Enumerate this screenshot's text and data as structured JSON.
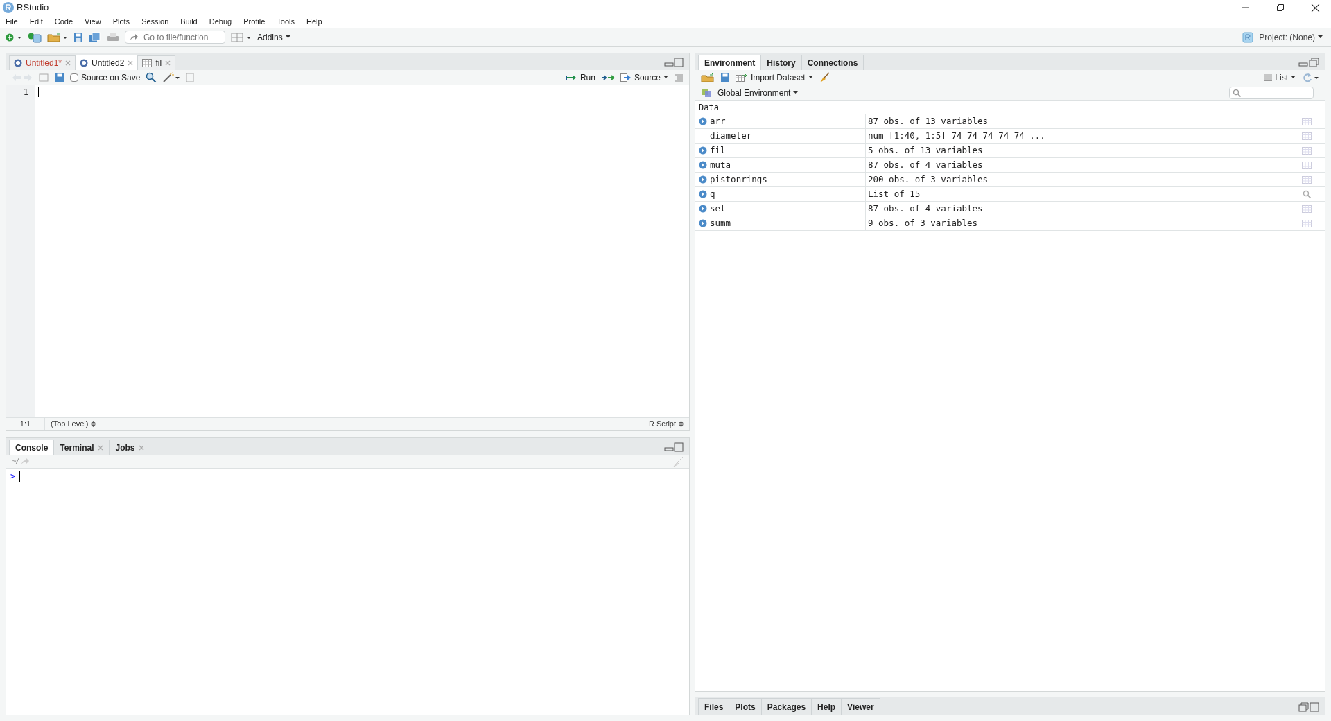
{
  "window": {
    "title": "RStudio"
  },
  "menu": [
    "File",
    "Edit",
    "Code",
    "View",
    "Plots",
    "Session",
    "Build",
    "Debug",
    "Profile",
    "Tools",
    "Help"
  ],
  "toolbar": {
    "goto_placeholder": "Go to file/function",
    "addins": "Addins",
    "project": "Project: (None)"
  },
  "editor": {
    "tabs": [
      {
        "label": "Untitled1*",
        "kind": "script",
        "selected": false,
        "modified": true
      },
      {
        "label": "Untitled2",
        "kind": "script",
        "selected": true,
        "modified": false
      },
      {
        "label": "fil",
        "kind": "data",
        "selected": false,
        "modified": false
      }
    ],
    "source_on_save": {
      "label": "Source on Save",
      "checked": false
    },
    "run": "Run",
    "source": "Source",
    "line_numbers": [
      "1"
    ],
    "status": {
      "position": "1:1",
      "scope": "(Top Level)",
      "file_type": "R Script"
    }
  },
  "console": {
    "tabs": [
      {
        "label": "Console",
        "selected": true,
        "closable": false
      },
      {
        "label": "Terminal",
        "selected": false,
        "closable": true
      },
      {
        "label": "Jobs",
        "selected": false,
        "closable": true
      }
    ],
    "path": "~/",
    "prompt": ">"
  },
  "environment": {
    "tabs": [
      {
        "label": "Environment",
        "selected": true
      },
      {
        "label": "History",
        "selected": false
      },
      {
        "label": "Connections",
        "selected": false
      }
    ],
    "import": "Import Dataset",
    "view": "List",
    "scope": "Global Environment",
    "section": "Data",
    "rows": [
      {
        "name": "arr",
        "value": "87 obs. of 13 variables",
        "expandable": true,
        "kind": "table"
      },
      {
        "name": "diameter",
        "value": "num [1:40, 1:5] 74 74 74 74 74 ...",
        "expandable": false,
        "kind": "table"
      },
      {
        "name": "fil",
        "value": "5 obs. of 13 variables",
        "expandable": true,
        "kind": "table"
      },
      {
        "name": "muta",
        "value": "87 obs. of 4 variables",
        "expandable": true,
        "kind": "table"
      },
      {
        "name": "pistonrings",
        "value": "200 obs. of 3 variables",
        "expandable": true,
        "kind": "table"
      },
      {
        "name": "q",
        "value": "List of 15",
        "expandable": true,
        "kind": "list"
      },
      {
        "name": "sel",
        "value": "87 obs. of 4 variables",
        "expandable": true,
        "kind": "table"
      },
      {
        "name": "summ",
        "value": "9 obs. of 3 variables",
        "expandable": true,
        "kind": "table"
      }
    ]
  },
  "files_pane": {
    "tabs": [
      {
        "label": "Files",
        "selected": false
      },
      {
        "label": "Plots",
        "selected": false
      },
      {
        "label": "Packages",
        "selected": false
      },
      {
        "label": "Help",
        "selected": false
      },
      {
        "label": "Viewer",
        "selected": false
      }
    ]
  }
}
